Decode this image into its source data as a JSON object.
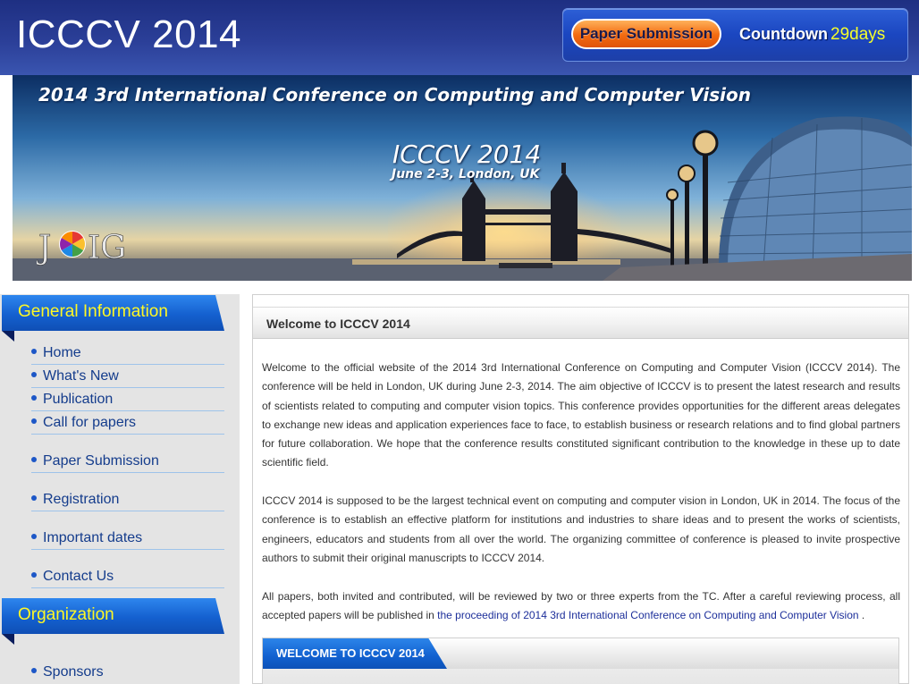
{
  "header": {
    "site_title": "ICCCV 2014",
    "paper_submission_label": "Paper Submission",
    "countdown_label": "Countdown",
    "countdown_value": "29days"
  },
  "banner": {
    "heading": "2014 3rd International Conference on Computing and Computer Vision",
    "conf_name": "ICCCV 2014",
    "conf_date": "June 2-3, London, UK",
    "logo_text": "JOIG"
  },
  "sidebar": {
    "general_heading": "General Information",
    "items": [
      {
        "label": "Home"
      },
      {
        "label": "What's New"
      },
      {
        "label": "Publication"
      },
      {
        "label": "Call for papers"
      },
      {
        "label": "Paper Submission"
      },
      {
        "label": "Registration"
      },
      {
        "label": "Important dates"
      },
      {
        "label": "Contact Us"
      }
    ],
    "organization_heading": "Organization",
    "org_items": [
      {
        "label": "Sponsors"
      }
    ]
  },
  "main": {
    "welcome_title": "Welcome to ICCCV 2014",
    "paragraph1": "Welcome to the official website of the 2014 3rd International Conference on Computing and Computer Vision (ICCCV 2014). The conference will be held in London, UK during June 2-3, 2014. The aim objective of ICCCV is to present the latest research and results of scientists related to computing and computer vision topics. This conference provides opportunities for the different areas delegates to exchange new ideas and application experiences face to face, to establish business or research relations and to find global partners for future collaboration. We hope that the conference results constituted significant contribution to the knowledge in these up to date scientific field.",
    "paragraph2": "ICCCV 2014 is supposed to be the largest technical event on computing and computer vision in London, UK in 2014. The focus of the conference is to establish an effective platform for institutions and industries to share ideas and to present the works of scientists, engineers, educators and students from all over the world. The organizing committee of conference is pleased to invite prospective authors to submit their original manuscripts to ICCCV 2014.",
    "paragraph3_prefix": "All papers, both invited and contributed, will be reviewed by two or three experts from the TC. After a careful reviewing process, all accepted papers will be published in",
    "paragraph3_link": "the proceeding of 2014 3rd International Conference on Computing and Computer Vision",
    "paragraph3_suffix": ".",
    "tab_label": "WELCOME TO ICCCV 2014"
  },
  "colors": {
    "header_blue": "#2b3f98",
    "sidebar_heading_blue": "#1460cf",
    "sidebar_heading_text": "#fff824",
    "nav_text": "#143c8c",
    "countdown_value": "#f6ff2a",
    "submission_orange": "#f26a10"
  }
}
